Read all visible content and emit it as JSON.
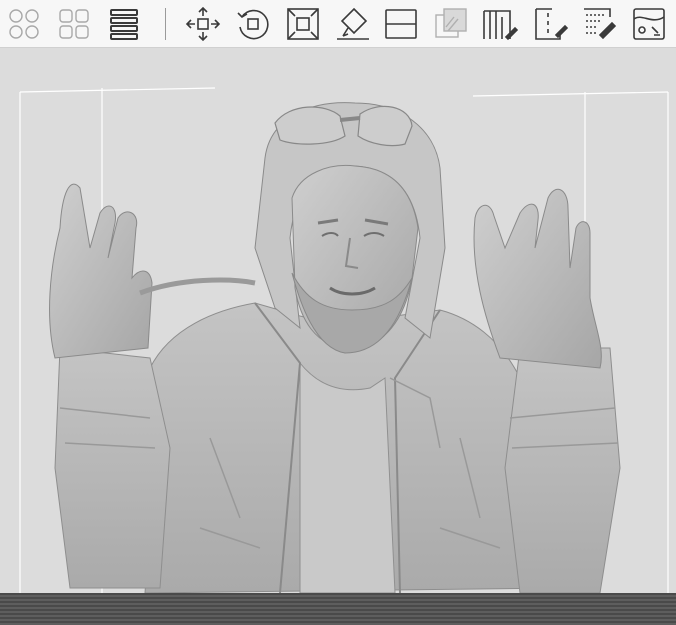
{
  "toolbar": {
    "tools": [
      {
        "icon": "layout-grid-circles-icon",
        "label": ""
      },
      {
        "icon": "layout-grid-quarters-icon",
        "label": ""
      },
      {
        "icon": "list-lines-icon",
        "label": ""
      },
      {
        "icon": "move-arrows-icon",
        "label": ""
      },
      {
        "icon": "rotate-icon",
        "label": ""
      },
      {
        "icon": "scale-frame-icon",
        "label": ""
      },
      {
        "icon": "place-on-face-icon",
        "label": ""
      },
      {
        "icon": "cut-icon",
        "label": ""
      },
      {
        "icon": "mesh-boolean-icon",
        "label": ""
      },
      {
        "icon": "support-paint-icon",
        "label": ""
      },
      {
        "icon": "seam-paint-icon",
        "label": ""
      },
      {
        "icon": "fuzzy-skin-paint-icon",
        "label": ""
      },
      {
        "icon": "color-paint-icon",
        "label": ""
      }
    ],
    "disabled_tool": "mesh-boolean-icon"
  },
  "viewport": {
    "background_color": "#dcdcdc",
    "model_color": "#b9b9b9",
    "bed_color": "#4f4f4f"
  }
}
